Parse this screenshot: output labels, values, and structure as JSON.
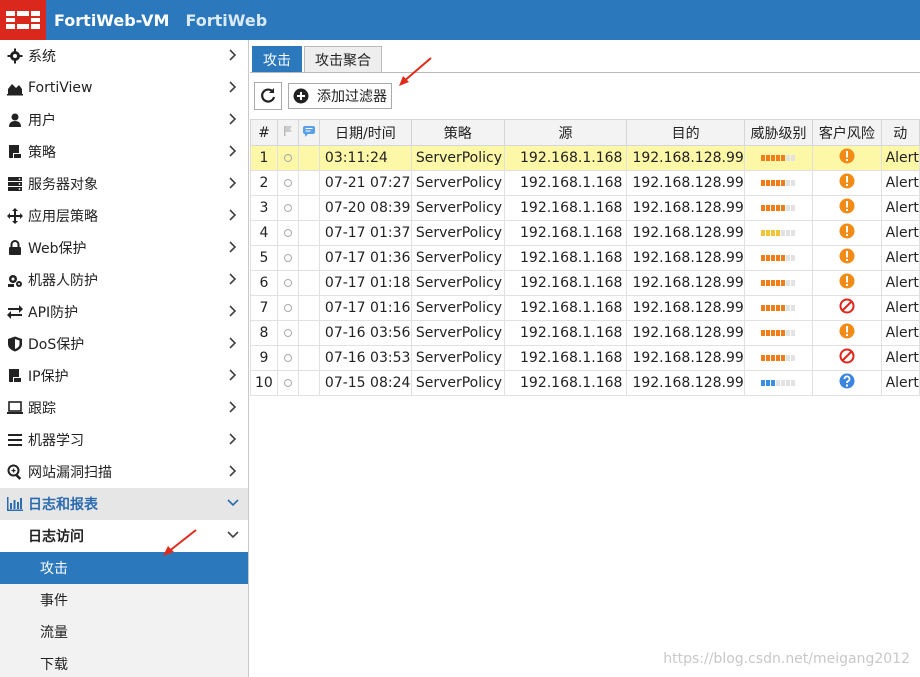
{
  "header": {
    "app_name": "FortiWeb-VM",
    "product": "FortiWeb",
    "brand_color": "#da291c",
    "bar_color": "#2b78bd"
  },
  "sidebar": {
    "items": [
      {
        "label": "系统",
        "icon": "gear-icon"
      },
      {
        "label": "FortiView",
        "icon": "area-chart-icon"
      },
      {
        "label": "用户",
        "icon": "user-icon"
      },
      {
        "label": "策略",
        "icon": "policy-doc-icon"
      },
      {
        "label": "服务器对象",
        "icon": "server-icon"
      },
      {
        "label": "应用层策略",
        "icon": "move-arrows-icon"
      },
      {
        "label": "Web保护",
        "icon": "lock-icon"
      },
      {
        "label": "机器人防护",
        "icon": "robot-icon"
      },
      {
        "label": "API防护",
        "icon": "exchange-icon"
      },
      {
        "label": "DoS保护",
        "icon": "shield-icon"
      },
      {
        "label": "IP保护",
        "icon": "ip-doc-icon"
      },
      {
        "label": "跟踪",
        "icon": "laptop-icon"
      },
      {
        "label": "机器学习",
        "icon": "list-icon"
      },
      {
        "label": "网站漏洞扫描",
        "icon": "scan-icon"
      }
    ],
    "open_section": {
      "label": "日志和报表",
      "icon": "bar-chart-icon"
    },
    "sub_section": {
      "label": "日志访问"
    },
    "sub_items": [
      {
        "label": "攻击",
        "active": true
      },
      {
        "label": "事件"
      },
      {
        "label": "流量"
      },
      {
        "label": "下载"
      }
    ]
  },
  "tabs": [
    {
      "label": "攻击",
      "active": true
    },
    {
      "label": "攻击聚合"
    }
  ],
  "toolbar": {
    "add_filter_label": "添加过滤器"
  },
  "table": {
    "headers": {
      "num": "#",
      "date": "日期/时间",
      "policy": "策略",
      "src": "源",
      "dst": "目的",
      "threat": "威胁级别",
      "client_risk": "客户风险",
      "last": "动"
    },
    "rows": [
      {
        "num": "1",
        "date": "03:11:24",
        "policy": "ServerPolicy",
        "src": "192.168.1.168",
        "dst": "192.168.128.99",
        "threat": "high",
        "risk": "warn",
        "action": "Alert",
        "selected": true
      },
      {
        "num": "2",
        "date": "07-21 07:27",
        "policy": "ServerPolicy",
        "src": "192.168.1.168",
        "dst": "192.168.128.99",
        "threat": "high",
        "risk": "warn",
        "action": "Alert"
      },
      {
        "num": "3",
        "date": "07-20 08:39",
        "policy": "ServerPolicy",
        "src": "192.168.1.168",
        "dst": "192.168.128.99",
        "threat": "high",
        "risk": "warn",
        "action": "Alert"
      },
      {
        "num": "4",
        "date": "07-17 01:37",
        "policy": "ServerPolicy",
        "src": "192.168.1.168",
        "dst": "192.168.128.99",
        "threat": "medium",
        "risk": "warn",
        "action": "Alert"
      },
      {
        "num": "5",
        "date": "07-17 01:36",
        "policy": "ServerPolicy",
        "src": "192.168.1.168",
        "dst": "192.168.128.99",
        "threat": "high",
        "risk": "warn",
        "action": "Alert"
      },
      {
        "num": "6",
        "date": "07-17 01:18",
        "policy": "ServerPolicy",
        "src": "192.168.1.168",
        "dst": "192.168.128.99",
        "threat": "high",
        "risk": "warn",
        "action": "Alert"
      },
      {
        "num": "7",
        "date": "07-17 01:16",
        "policy": "ServerPolicy",
        "src": "192.168.1.168",
        "dst": "192.168.128.99",
        "threat": "high",
        "risk": "block",
        "action": "Alert"
      },
      {
        "num": "8",
        "date": "07-16 03:56",
        "policy": "ServerPolicy",
        "src": "192.168.1.168",
        "dst": "192.168.128.99",
        "threat": "high",
        "risk": "warn",
        "action": "Alert"
      },
      {
        "num": "9",
        "date": "07-16 03:53",
        "policy": "ServerPolicy",
        "src": "192.168.1.168",
        "dst": "192.168.128.99",
        "threat": "high",
        "risk": "block",
        "action": "Alert"
      },
      {
        "num": "10",
        "date": "07-15 08:24",
        "policy": "ServerPolicy",
        "src": "192.168.1.168",
        "dst": "192.168.128.99",
        "threat": "low",
        "risk": "unknown",
        "action": "Alert"
      }
    ]
  },
  "threat_colors": {
    "high": "#f07c1a",
    "medium": "#f2c43a",
    "low": "#3b8fe0"
  },
  "watermark": "https://blog.csdn.net/meigang2012"
}
